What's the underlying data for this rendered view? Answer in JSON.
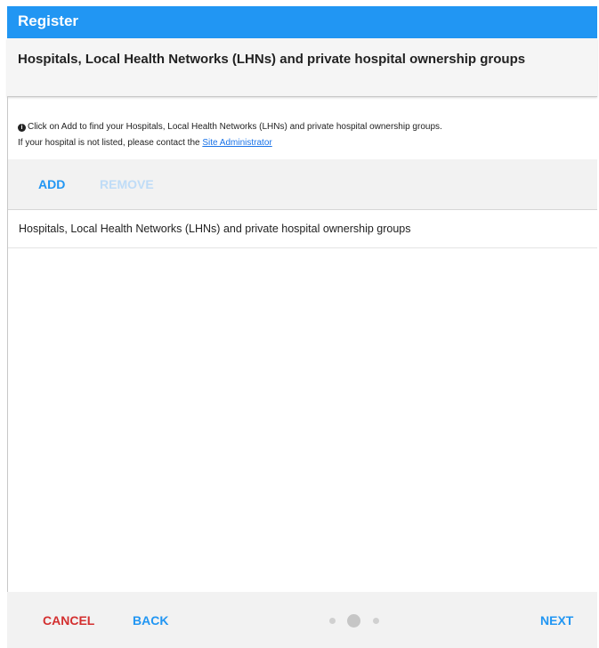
{
  "window": {
    "title": "Register"
  },
  "section": {
    "heading": "Hospitals, Local Health Networks (LHNs) and private hospital ownership groups"
  },
  "info": {
    "icon": "info-circle-icon",
    "line1": "Click on Add to find your Hospitals, Local Health Networks (LHNs) and private hospital ownership groups.",
    "line2_prefix": "If your hospital is not listed, please contact the ",
    "link_text": "Site Administrator"
  },
  "toolbar": {
    "add_label": "ADD",
    "remove_label": "REMOVE"
  },
  "table": {
    "columns": [
      "Hospitals, Local Health Networks (LHNs) and private hospital ownership groups"
    ],
    "rows": []
  },
  "footer": {
    "cancel_label": "CANCEL",
    "back_label": "BACK",
    "next_label": "NEXT",
    "steps_total": 3,
    "current_step": 2
  },
  "colors": {
    "accent": "#2196f3",
    "danger": "#d32f2f",
    "disabled": "#bfdcf7"
  }
}
